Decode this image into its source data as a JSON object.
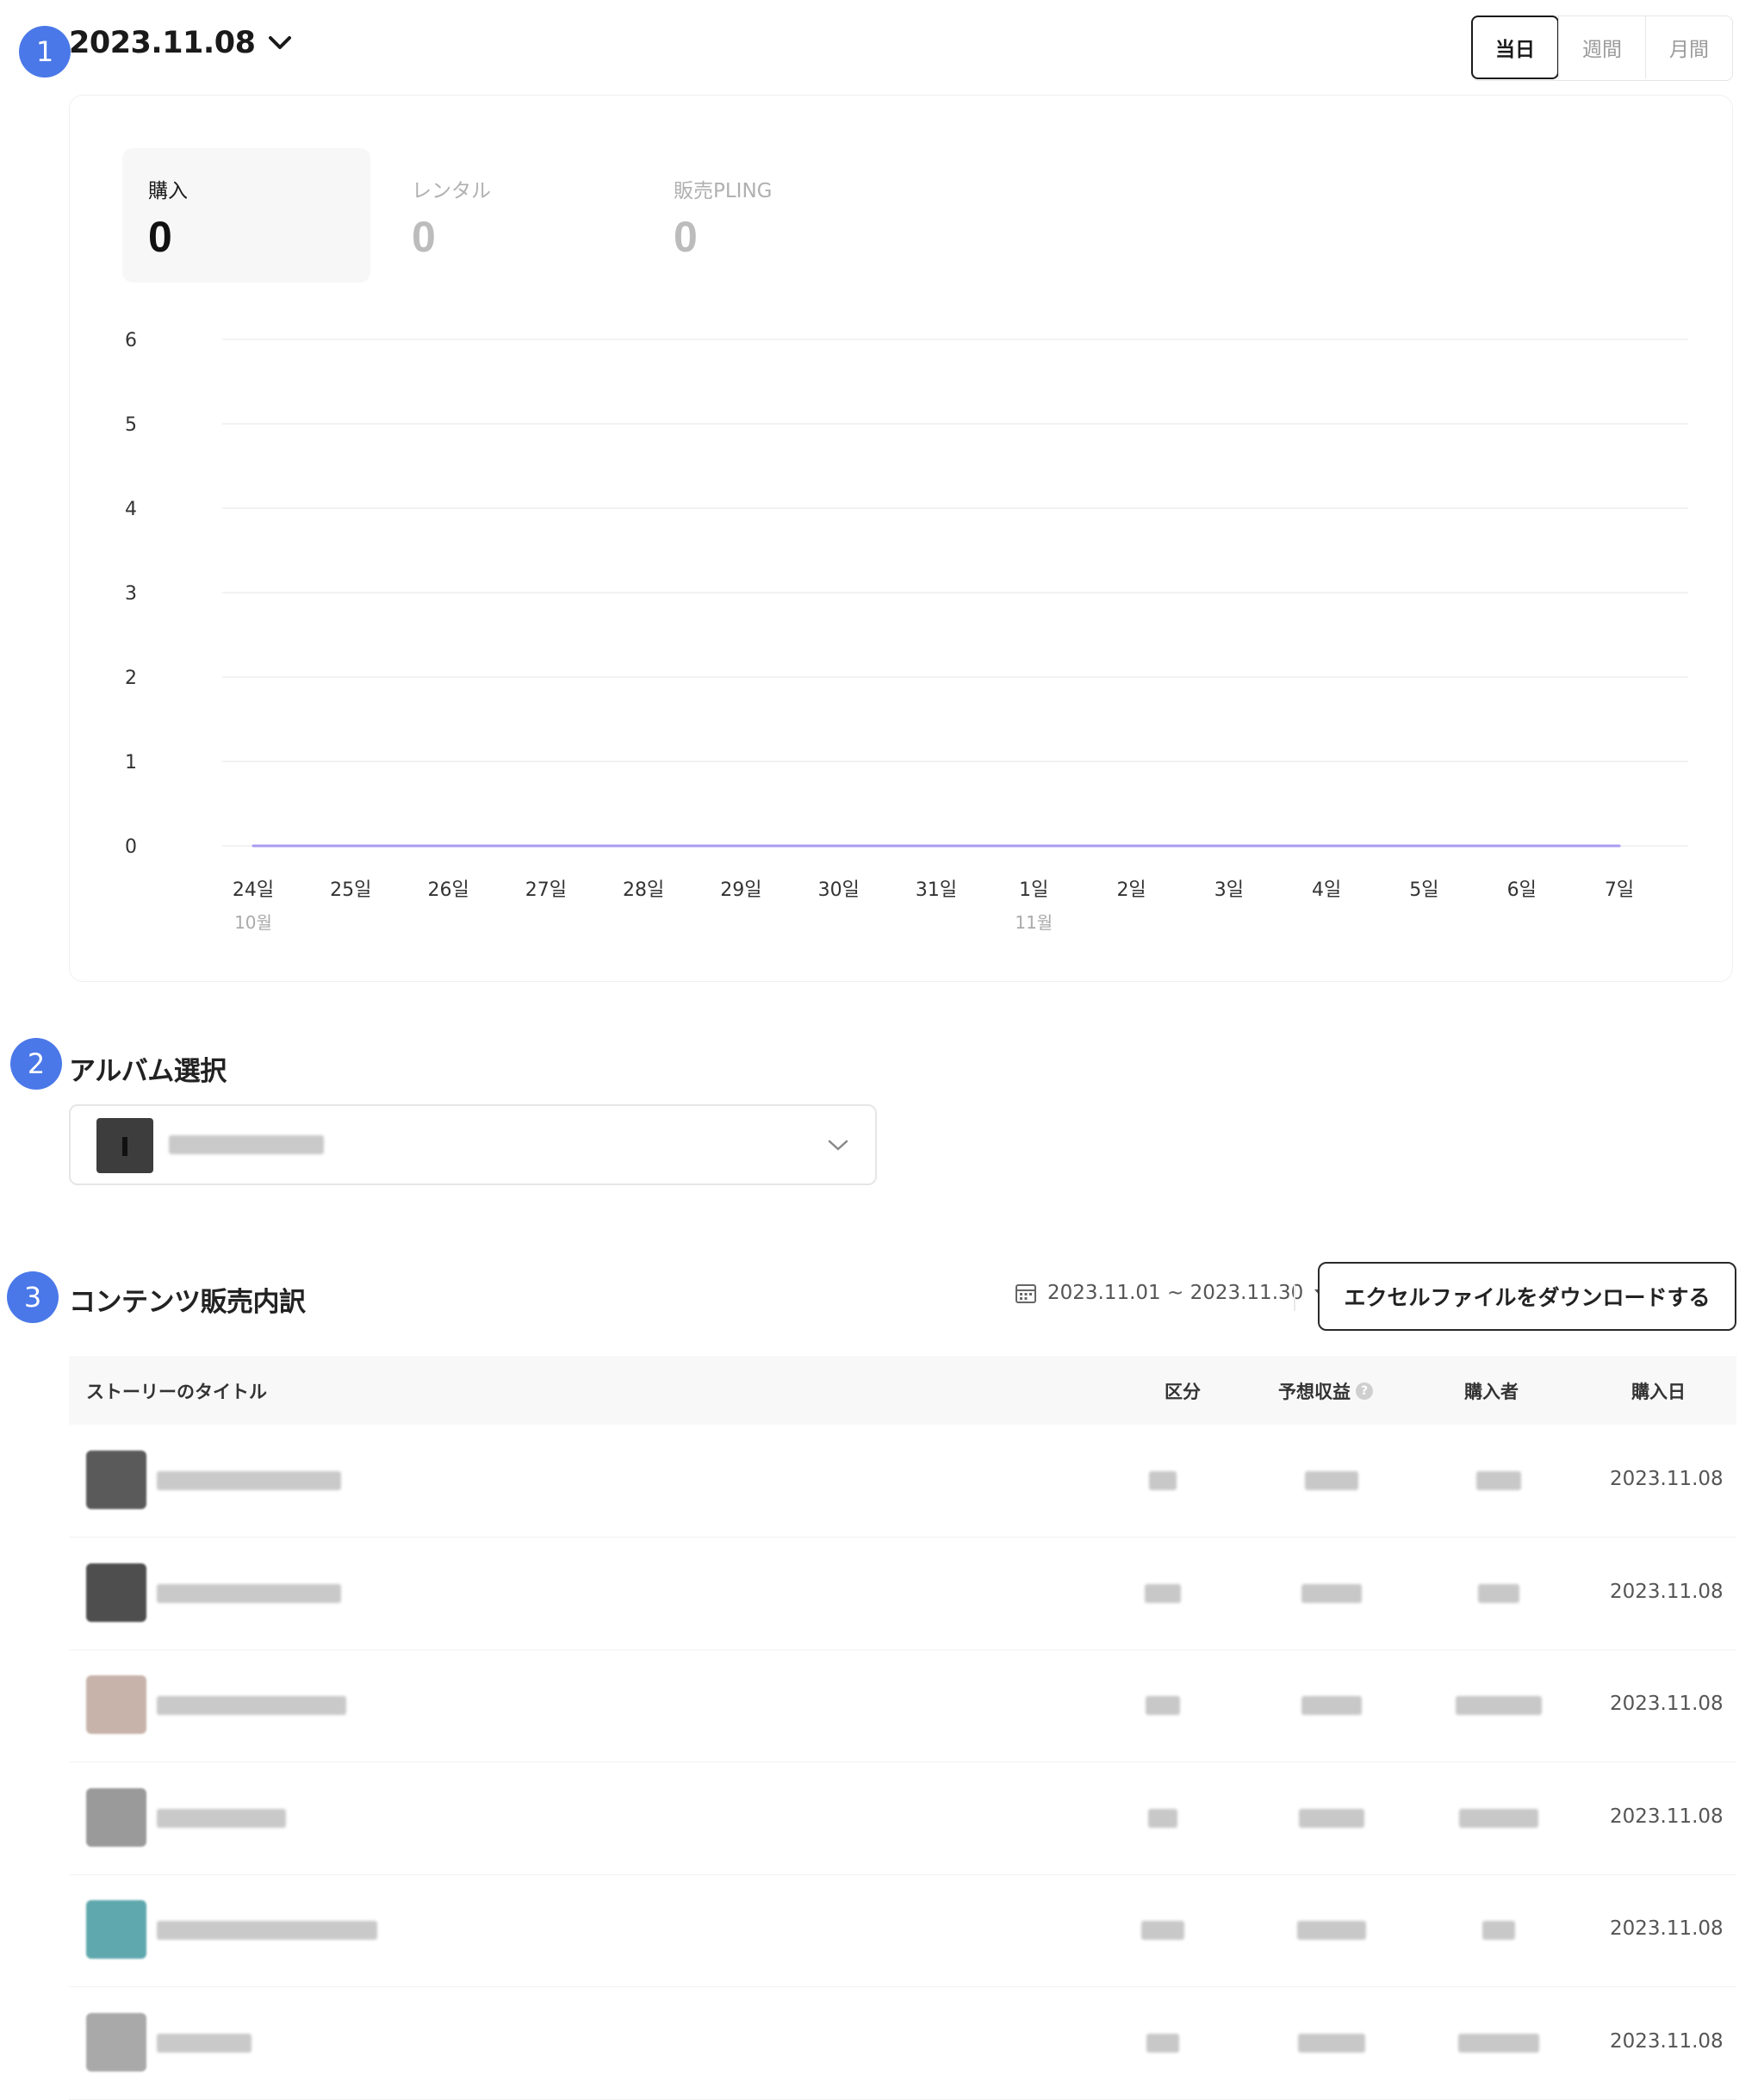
{
  "header": {
    "date": "2023.11.08",
    "period_tabs": [
      {
        "label": "当日",
        "active": true
      },
      {
        "label": "週間",
        "active": false
      },
      {
        "label": "月間",
        "active": false
      }
    ]
  },
  "markers": [
    "1",
    "2",
    "3"
  ],
  "stats": [
    {
      "label": "購入",
      "value": "0",
      "active": true
    },
    {
      "label": "レンタル",
      "value": "0",
      "active": false
    },
    {
      "label": "販売PLING",
      "value": "0",
      "active": false
    }
  ],
  "chart_data": {
    "type": "line",
    "categories": [
      "24일",
      "25일",
      "26일",
      "27일",
      "28일",
      "29일",
      "30일",
      "31일",
      "1일",
      "2일",
      "3일",
      "4일",
      "5일",
      "6일",
      "7일"
    ],
    "month_labels": [
      {
        "at": "24일",
        "label": "10월"
      },
      {
        "at": "1일",
        "label": "11월"
      }
    ],
    "series": [
      {
        "values": [
          0,
          0,
          0,
          0,
          0,
          0,
          0,
          0,
          0,
          0,
          0,
          0,
          0,
          0,
          0
        ],
        "color": "#a89bf0"
      }
    ],
    "yticks": [
      "0",
      "1",
      "2",
      "3",
      "4",
      "5",
      "6"
    ],
    "ylim": [
      0,
      6
    ],
    "grid": true
  },
  "album": {
    "title": "アルバム選択"
  },
  "sales": {
    "title": "コンテンツ販売内訳",
    "range": "2023.11.01 ~ 2023.11.30",
    "excel_button": "エクセルファイルをダウンロードする",
    "columns": [
      "ストーリーのタイトル",
      "区分",
      "予想収益",
      "購入者",
      "購入日"
    ],
    "rows": [
      {
        "date": "2023.11.08",
        "thumb": "#5a5a5a"
      },
      {
        "date": "2023.11.08",
        "thumb": "#4e4e4e"
      },
      {
        "date": "2023.11.08",
        "thumb": "#c7b3aa"
      },
      {
        "date": "2023.11.08",
        "thumb": "#9a9a9a"
      },
      {
        "date": "2023.11.08",
        "thumb": "#5fa8ad"
      },
      {
        "date": "2023.11.08",
        "thumb": "#a9a9a9"
      }
    ]
  },
  "colors": {
    "accent": "#4a78e8",
    "line": "#a89bf0"
  }
}
